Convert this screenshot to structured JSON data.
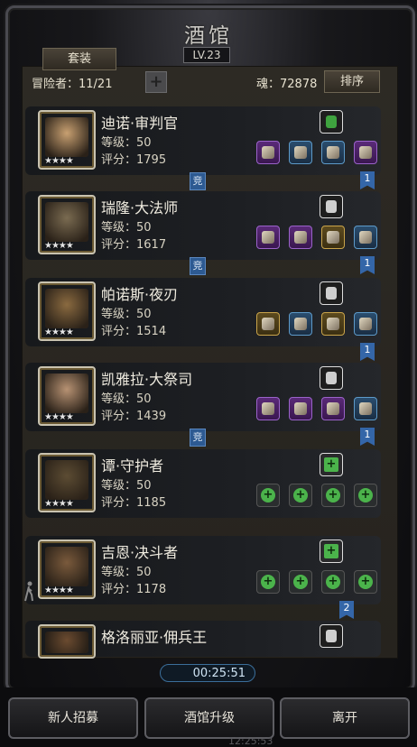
{
  "header": {
    "title": "酒馆",
    "level": "LV.23"
  },
  "toolbar": {
    "set_label": "套装",
    "adventurer_count": "冒险者：11/21",
    "add_label": "+",
    "soul": "魂：72878",
    "sort_label": "排序"
  },
  "heroes": [
    {
      "name": "迪诺·审判官",
      "level": "等级：50",
      "score": "评分：1795",
      "stars": "★★★★",
      "slots": [
        "purple",
        "blue",
        "blue",
        "purple"
      ],
      "arena": "竞",
      "ribbon": "1",
      "portrait_color": "#c8a071"
    },
    {
      "name": "瑞隆·大法师",
      "level": "等级：50",
      "score": "评分：1617",
      "stars": "★★★★",
      "slots": [
        "purple",
        "purple",
        "gold",
        "blue"
      ],
      "arena": "竞",
      "ribbon": "1",
      "portrait_color": "#7a6b51"
    },
    {
      "name": "帕诺斯·夜刃",
      "level": "等级：50",
      "score": "评分：1514",
      "stars": "★★★★",
      "slots": [
        "gold",
        "blue",
        "gold",
        "blue"
      ],
      "arena": "",
      "ribbon": "1",
      "portrait_color": "#8a6a40"
    },
    {
      "name": "凯雅拉·大祭司",
      "level": "等级：50",
      "score": "评分：1439",
      "stars": "★★★★",
      "slots": [
        "purple",
        "purple",
        "purple",
        "blue"
      ],
      "arena": "竞",
      "ribbon": "1",
      "portrait_color": "#b79273"
    },
    {
      "name": "谭·守护者",
      "level": "等级：50",
      "score": "评分：1185",
      "stars": "★★★★",
      "slots": [
        "empty",
        "empty",
        "empty",
        "empty"
      ],
      "arena": "",
      "ribbon": "",
      "portrait_color": "#5c4c33"
    },
    {
      "name": "吉恩·决斗者",
      "level": "等级：50",
      "score": "评分：1178",
      "stars": "★★★★",
      "slots": [
        "empty",
        "empty",
        "empty",
        "empty"
      ],
      "arena": "",
      "ribbon": "2",
      "portrait_color": "#7a5a3c"
    },
    {
      "name": "格洛丽亚·佣兵王",
      "level": "",
      "score": "",
      "stars": "",
      "slots": [],
      "arena": "",
      "ribbon": "",
      "portrait_color": "#6b4b30"
    }
  ],
  "timer": "00:25:51",
  "clock": "12:25:53",
  "buttons": {
    "recruit": "新人招募",
    "upgrade": "酒馆升级",
    "leave": "离开"
  },
  "colors": {
    "panel": "#2d2a24",
    "card": "#1b1d21",
    "arena_blue": "#2d5a92"
  }
}
